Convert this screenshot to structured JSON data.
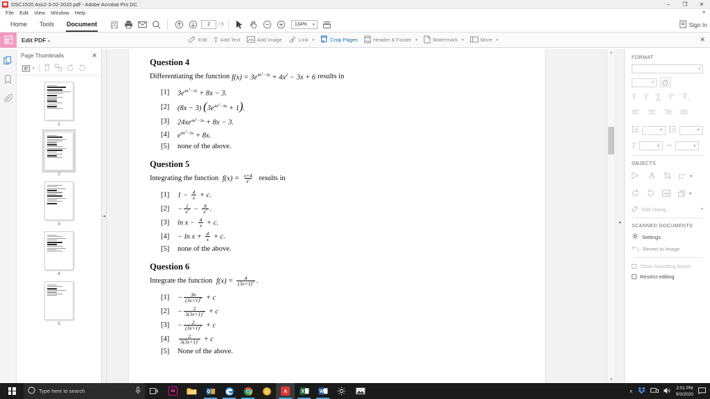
{
  "window": {
    "title": "DSC1520 Ass2-3-02-2020.pdf - Adobe Acrobat Pro DC",
    "app_icon": "acrobat-icon",
    "minimize": "–",
    "restore": "❐",
    "close": "✕"
  },
  "menubar": {
    "items": [
      "File",
      "Edit",
      "View",
      "Window",
      "Help"
    ],
    "close_doc": "✕"
  },
  "tabstrip": {
    "tabs": [
      {
        "label": "Home",
        "active": false
      },
      {
        "label": "Tools",
        "active": false
      },
      {
        "label": "Document",
        "active": true
      }
    ],
    "icons": [
      "save-icon",
      "print-icon",
      "email-icon",
      "search-icon"
    ],
    "nav_icons": [
      "previous-page-icon",
      "next-page-icon"
    ],
    "page_current": "2",
    "page_total": "/ 5",
    "tool_icons": [
      "select-tool-icon",
      "hand-tool-icon",
      "zoom-out-icon",
      "zoom-in-icon"
    ],
    "zoom_value": "134%",
    "fit_icon": "fit-page-icon",
    "signin_label": "Sign In",
    "signin_icon": "account-icon",
    "close_pane": "✕"
  },
  "edit_toolbar": {
    "badge_icon": "edit-pdf-icon",
    "title": "Edit PDF",
    "title_caret": "▾",
    "tools": [
      {
        "label": "Edit",
        "icon": "edit-icon",
        "active": false,
        "caret": ""
      },
      {
        "label": "Add Text",
        "icon": "add-text-icon",
        "active": false,
        "caret": ""
      },
      {
        "label": "Add Image",
        "icon": "add-image-icon",
        "active": false,
        "caret": ""
      },
      {
        "label": "Link",
        "icon": "link-icon",
        "active": false,
        "caret": "▾"
      },
      {
        "label": "Crop Pages",
        "icon": "crop-pages-icon",
        "active": true,
        "caret": ""
      },
      {
        "label": "Header & Footer",
        "icon": "header-footer-icon",
        "active": false,
        "caret": "▾"
      },
      {
        "label": "Watermark",
        "icon": "watermark-icon",
        "active": false,
        "caret": "▾"
      },
      {
        "label": "More",
        "icon": "more-icon",
        "active": false,
        "caret": "▾"
      }
    ],
    "close": "✕"
  },
  "navrail": {
    "items": [
      {
        "name": "page-thumbnails-icon",
        "active": true
      },
      {
        "name": "bookmarks-icon",
        "active": false
      },
      {
        "name": "attachments-icon",
        "active": false
      }
    ]
  },
  "thumbnails_panel": {
    "title": "Page Thumbnails",
    "close": "✕",
    "toolbar": [
      {
        "name": "thumbnail-size-icon",
        "caret": "▾",
        "enabled": true
      },
      {
        "name": "delete-pages-icon",
        "caret": "",
        "enabled": false
      },
      {
        "name": "extract-pages-icon",
        "caret": "",
        "enabled": false
      },
      {
        "name": "rotate-ccw-icon",
        "caret": "",
        "enabled": false
      },
      {
        "name": "rotate-cw-icon",
        "caret": "",
        "enabled": false
      }
    ],
    "pages": [
      {
        "number": "1",
        "selected": false
      },
      {
        "number": "2",
        "selected": true
      },
      {
        "number": "3",
        "selected": false
      },
      {
        "number": "4",
        "selected": false
      },
      {
        "number": "5",
        "selected": false
      }
    ]
  },
  "document": {
    "questions": [
      {
        "title": "Question 4",
        "stem_prefix": "Differentiating the function",
        "stem_fn": "f(x) = 3e",
        "stem_exp": "4x²−3x",
        "stem_suffix": "+ 4x² − 3x + 6 results in",
        "options": [
          {
            "label": "[1]",
            "text": "3e^(4x²−3x) + 8x − 3."
          },
          {
            "label": "[2]",
            "text": "(8x − 3)(3e^(4x²−3x) + 1)."
          },
          {
            "label": "[3]",
            "text": "24xe^(4x²−3x) + 8x − 3."
          },
          {
            "label": "[4]",
            "text": "e^(4x²−3x) + 8x."
          },
          {
            "label": "[5]",
            "text": "none of the above."
          }
        ]
      },
      {
        "title": "Question 5",
        "stem_prefix": "Integrating the function",
        "stem_fn": "f(x) =",
        "stem_num": "x+4",
        "stem_den": "x²",
        "stem_suffix": "results in",
        "options": [
          {
            "label": "[1]",
            "text": "1 − 4/x + c."
          },
          {
            "label": "[2]",
            "text": "−1/x² − 8/x³."
          },
          {
            "label": "[3]",
            "text": "ln x − 4/x + c."
          },
          {
            "label": "[4]",
            "text": "− ln x + 4/x + c."
          },
          {
            "label": "[5]",
            "text": "none of the above."
          }
        ]
      },
      {
        "title": "Question 6",
        "stem_prefix": "Integrate the function",
        "stem_fn": "f(x) =",
        "stem_num": "4",
        "stem_den": "(3x+1)³",
        "stem_suffix": ".",
        "options": [
          {
            "label": "[1]",
            "text": "−36/(3x+1)⁴ + c"
          },
          {
            "label": "[2]",
            "text": "−2/3(3x+1)² + c"
          },
          {
            "label": "[3]",
            "text": "−2/(3x+1)³ + c"
          },
          {
            "label": "[4]",
            "text": "2/3(3x+1)² + c"
          },
          {
            "label": "[5]",
            "text": "None of the above."
          }
        ]
      }
    ]
  },
  "right_panel": {
    "format": {
      "heading": "FORMAT",
      "font_value": "",
      "font_caret": "▾",
      "size_value": "",
      "size_caret": "▾",
      "color_icon": "text-color-icon",
      "style_icons": [
        "bold-icon",
        "italic-icon",
        "underline-icon",
        "superscript-icon",
        "subscript-icon"
      ],
      "align_icons": [
        "align-left-icon",
        "align-center-icon",
        "align-right-icon",
        "align-justify-icon"
      ],
      "line_spacing_icon": "line-spacing-icon",
      "line_spacing_value": "",
      "paragraph_spacing_icon": "paragraph-spacing-icon",
      "paragraph_spacing_value": "",
      "horizontal_scale_icon": "horizontal-scale-icon",
      "horizontal_scale_value": "",
      "char_spacing_icon": "character-spacing-icon",
      "char_spacing_label": "AV",
      "char_spacing_value": ""
    },
    "objects": {
      "heading": "OBJECTS",
      "icons": [
        "flip-horizontal-icon",
        "flip-vertical-icon",
        "crop-image-icon",
        "align-objects-icon",
        "rotate-ccw-icon",
        "rotate-cw-icon",
        "replace-image-icon",
        "arrange-icon"
      ],
      "edit_using_icon": "edit-using-icon",
      "edit_using_label": "Edit Using...",
      "edit_using_caret": "▾"
    },
    "scanned": {
      "heading": "SCANNED DOCUMENTS",
      "settings_icon": "gear-icon",
      "settings_label": "Settings",
      "revert_icon": "revert-icon",
      "revert_label": "Revert to Image",
      "show_boxes_label": "Show bounding boxes",
      "restrict_label": "Restrict editing"
    }
  },
  "taskbar": {
    "start_icon": "windows-start-icon",
    "search_placeholder": "Type here to search",
    "mic_icon": "microphone-icon",
    "taskview_icon": "task-view-icon",
    "apps": [
      {
        "name": "indesign-icon",
        "glyph": "Id",
        "bg": "#d21a7d",
        "running": false,
        "active": false
      },
      {
        "name": "file-explorer-icon",
        "glyph": "",
        "bg": "#f5bc42",
        "running": false,
        "active": false
      },
      {
        "name": "outlook-icon",
        "glyph": "",
        "bg": "#e8a33d",
        "running": true,
        "active": false
      },
      {
        "name": "edge-icon",
        "glyph": "e",
        "bg": "#1a7fd4",
        "running": true,
        "active": false
      },
      {
        "name": "chrome-icon",
        "glyph": "",
        "bg": "#1f9c4a",
        "running": true,
        "active": false
      },
      {
        "name": "firefox-icon",
        "glyph": "",
        "bg": "#f0b429",
        "running": false,
        "active": false
      },
      {
        "name": "acrobat-icon",
        "glyph": "A",
        "bg": "#d93b32",
        "running": true,
        "active": true
      },
      {
        "name": "excel-icon",
        "glyph": "X",
        "bg": "#1d6f42",
        "running": true,
        "active": false
      },
      {
        "name": "word-icon",
        "glyph": "W",
        "bg": "#2b579a",
        "running": true,
        "active": false
      },
      {
        "name": "settings-icon",
        "glyph": "",
        "bg": "#3a3a3a",
        "running": false,
        "active": false
      },
      {
        "name": "photos-icon",
        "glyph": "",
        "bg": "#3a3a3a",
        "running": false,
        "active": false
      }
    ],
    "tray": {
      "chevron": "∧",
      "dropbox_icon": "dropbox-icon",
      "network_icon": "network-icon",
      "volume_icon": "volume-icon",
      "time": "2:01 PM",
      "date": "9/3/2020",
      "notification_icon": "notifications-icon"
    }
  },
  "colors": {
    "accent_pink": "#f49ac1",
    "accent_blue": "#1d6fb8",
    "acrobat_red": "#d93b32",
    "taskbar_bg": "#1b1b1b"
  }
}
